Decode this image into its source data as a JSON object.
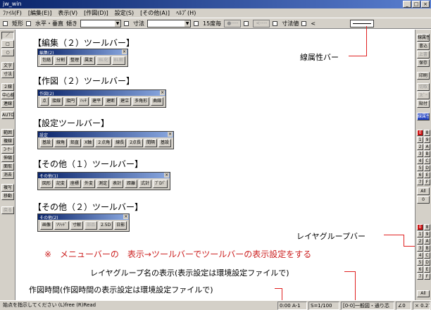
{
  "window": {
    "title": "jw_win",
    "buttons": [
      "_",
      "□",
      "×"
    ]
  },
  "menubar": {
    "items": [
      "ﾌｧｲﾙ(F)",
      "[編集(E)]",
      "表示(V)",
      "[作図(D)]",
      "設定(S)",
      "[その他(A)]",
      "ﾍﾙﾌﾟ(H)"
    ]
  },
  "optionbar": {
    "rect_label": "矩形",
    "hv_label": "水平・垂直",
    "tilt_label": "傾き",
    "dim_label": "寸法",
    "n15_label": "15度毎",
    "btn1": "●----",
    "btn2": "<----",
    "dimval_label": "寸法値",
    "lt_label": "<"
  },
  "left_toolbar": [
    "／",
    "□",
    "○",
    "文字",
    "寸法",
    "２線",
    "中心線",
    "連線",
    "AUTO",
    "範囲",
    "複線",
    "ｺｰﾅｰ",
    "伸縮",
    "面取",
    "消去",
    "複写",
    "移動",
    "戻る"
  ],
  "right_toolbar": {
    "top": [
      "線属性",
      "書込",
      "上書",
      "保存",
      "印刷",
      "切取",
      "ｺﾋﾟｰ",
      "貼付",
      "線属性"
    ],
    "layer_cells": [
      "0",
      "8",
      "1",
      "9",
      "2",
      "A",
      "3",
      "B",
      "4",
      "C",
      "5",
      "D",
      "6",
      "E",
      "7",
      "F"
    ],
    "all_label": "All",
    "zero_label": "0",
    "group_cells": [
      "0",
      "8",
      "1",
      "9",
      "2",
      "A",
      "3",
      "B",
      "4",
      "C",
      "5",
      "D",
      "6",
      "E",
      "7",
      "F"
    ],
    "group_all_label": "All"
  },
  "sections": [
    {
      "heading": "【編集（２）ツールバー】",
      "caption": "編集(2)",
      "buttons": [
        {
          "label": "包絡",
          "dim": false
        },
        {
          "label": "分割",
          "dim": false
        },
        {
          "label": "整理",
          "dim": false
        },
        {
          "label": "属変",
          "dim": false
        },
        {
          "label": "BL化",
          "dim": true
        },
        {
          "label": "BL解",
          "dim": true
        }
      ]
    },
    {
      "heading": "【作図（２）ツールバー】",
      "caption": "作図(2)",
      "buttons": [
        {
          "label": "点",
          "dim": false
        },
        {
          "label": "接線",
          "dim": false
        },
        {
          "label": "接円",
          "dim": false
        },
        {
          "label": "ﾊｯﾁ",
          "dim": false
        },
        {
          "label": "建平",
          "dim": false
        },
        {
          "label": "建断",
          "dim": false
        },
        {
          "label": "建立",
          "dim": false
        },
        {
          "label": "多角形",
          "dim": false
        },
        {
          "label": "曲線",
          "dim": false
        }
      ]
    },
    {
      "heading": "【設定ツールバー】",
      "caption": "設定",
      "buttons": [
        {
          "label": "基設",
          "dim": false
        },
        {
          "label": "線角",
          "dim": false
        },
        {
          "label": "鉛直",
          "dim": false
        },
        {
          "label": "X軸",
          "dim": false
        },
        {
          "label": "２点角",
          "dim": false
        },
        {
          "label": "線長",
          "dim": false
        },
        {
          "label": "2点長",
          "dim": false
        },
        {
          "label": "間隔",
          "dim": false
        },
        {
          "label": "基設",
          "dim": false
        }
      ]
    },
    {
      "heading": "【その他（１）ツールバー】",
      "caption": "その他(1)",
      "buttons": [
        {
          "label": "図形",
          "dim": false
        },
        {
          "label": "記変",
          "dim": false
        },
        {
          "label": "座標",
          "dim": false
        },
        {
          "label": "外変",
          "dim": false
        },
        {
          "label": "測定",
          "dim": false
        },
        {
          "label": "表計",
          "dim": false
        },
        {
          "label": "距離",
          "dim": false
        },
        {
          "label": "式計",
          "dim": false
        },
        {
          "label": "ﾌﾟﾛﾊﾟ",
          "dim": false
        }
      ]
    },
    {
      "heading": "【その他（２）ツールバー】",
      "caption": "その他(2)",
      "buttons": [
        {
          "label": "画像",
          "dim": false
        },
        {
          "label": "ｿﾘｯﾄﾞ",
          "dim": false
        },
        {
          "label": "寸解",
          "dim": false
        },
        {
          "label": "部品",
          "dim": true
        },
        {
          "label": "2.5D",
          "dim": false
        },
        {
          "label": "日影",
          "dim": false
        }
      ]
    }
  ],
  "callouts": {
    "line_attr": "線属性バー",
    "layer_group_bar": "レイヤグループバー",
    "layer_group_name": "レイヤグループ名の表示(表示設定は環境設定ファイルで)",
    "draw_time": "作図時間(作図時間の表示設定は環境設定ファイルで)",
    "note": "※　メニューバーの　表示→ツールバーでツールバーの表示設定をする"
  },
  "statusbar": {
    "message": "始点を指示してください (L)free (R)Read",
    "time": "0:00 A-1",
    "scale": "S=1/100",
    "group": "[0-0]一般図・通り芯",
    "angle": "∠0",
    "zoom": "× 0.27"
  },
  "colors": {
    "accent_red": "#e02020",
    "title_blue": "#0a246a"
  }
}
